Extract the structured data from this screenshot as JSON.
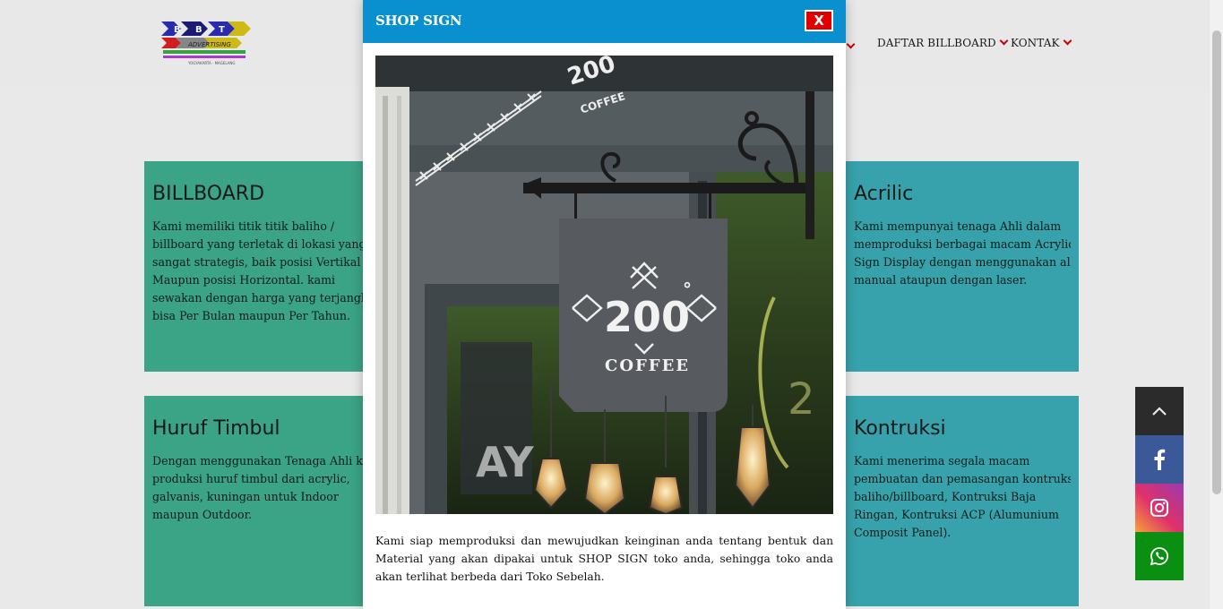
{
  "logo": {
    "letters": [
      "B",
      "B",
      "T"
    ],
    "tagline": "ADVERTISING",
    "sub": "YOGYAKARTA · MAGELANG"
  },
  "nav": {
    "items": [
      {
        "label": "DAFTAR BILLBOARD"
      },
      {
        "label": "KONTAK"
      }
    ]
  },
  "cards": [
    {
      "title": "BILLBOARD",
      "lines": [
        "Kami memiliki titik titik baliho /",
        "billboard yang terletak di lokasi yang",
        "sangat strategis, baik posisi Vertikal",
        "Maupun posisi Horizontal. kami",
        "sewakan dengan harga yang terjangkau",
        "bisa Per Bulan maupun Per Tahun."
      ]
    },
    {
      "title": "Acrilic",
      "lines": [
        "Kami mempunyai tenaga Ahli dalam",
        "memproduksi berbagai macam Acrylic",
        "Sign Display dengan menggunakan alat",
        "manual ataupun dengan laser."
      ]
    },
    {
      "title": "Huruf Timbul",
      "lines": [
        "Dengan menggunakan Tenaga Ahli kami",
        "produksi huruf timbul dari acrylic,",
        "galvanis, kuningan untuk Indoor",
        "maupun Outdoor."
      ]
    },
    {
      "title": "Kontruksi",
      "lines": [
        "Kami menerima segala macam",
        "pembuatan dan pemasangan kontruksi",
        "baliho/billboard, Kontruksi Baja",
        "Ringan, Kontruksi ACP (Alumunium",
        "Composit Panel)."
      ]
    }
  ],
  "modal": {
    "title": "SHOP SIGN",
    "close_label": "X",
    "photo": {
      "sign_number": "200",
      "sign_degree": "°",
      "sign_word": "COFFEE",
      "window_number": "200",
      "window_word": "COFFEE"
    },
    "description": "Kami siap memproduksi dan mewujudkan keinginan anda tentang bentuk dan Material yang akan dipakai untuk SHOP SIGN toko anda, sehingga toko anda akan terlihat berbeda dari Toko Sebelah."
  },
  "social": [
    {
      "icon": "chevron-up-icon",
      "color": "#2b2b2b"
    },
    {
      "icon": "facebook-icon",
      "color": "#3b5998"
    },
    {
      "icon": "instagram-icon",
      "color": "#e1306c"
    },
    {
      "icon": "whatsapp-icon",
      "color": "#0a8f13"
    }
  ]
}
